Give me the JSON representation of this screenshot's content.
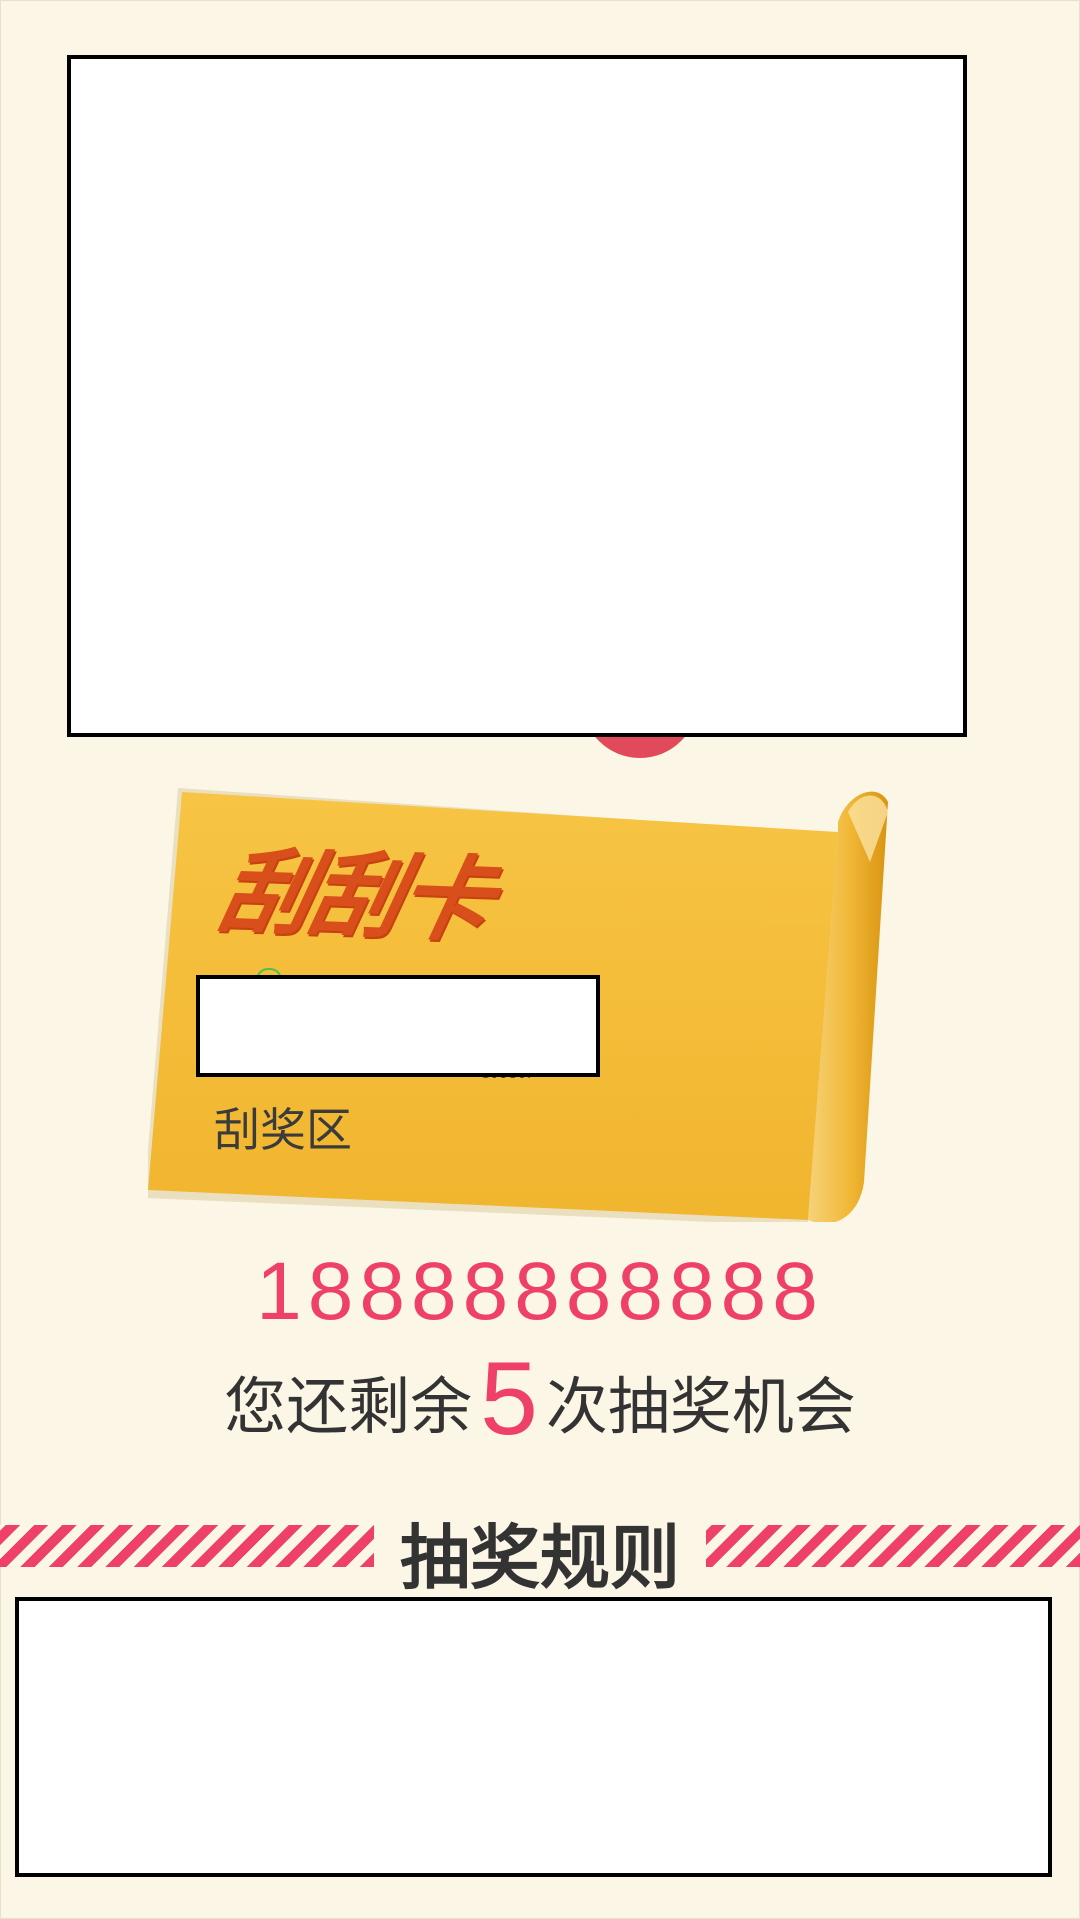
{
  "card": {
    "title": "刮刮卡",
    "tiny_text": "CMON",
    "area_label": "刮奖区"
  },
  "user": {
    "phone": "18888888888"
  },
  "chances": {
    "prefix": "您还剩余",
    "count": "5",
    "suffix": "次抽奖机会"
  },
  "rules": {
    "title": "抽奖规则"
  },
  "colors": {
    "background": "#fbf6e6",
    "accent_pink": "#ee4068",
    "card_gold": "#f3b936",
    "title_orange": "#d94f1b",
    "text_dark": "#333333"
  }
}
